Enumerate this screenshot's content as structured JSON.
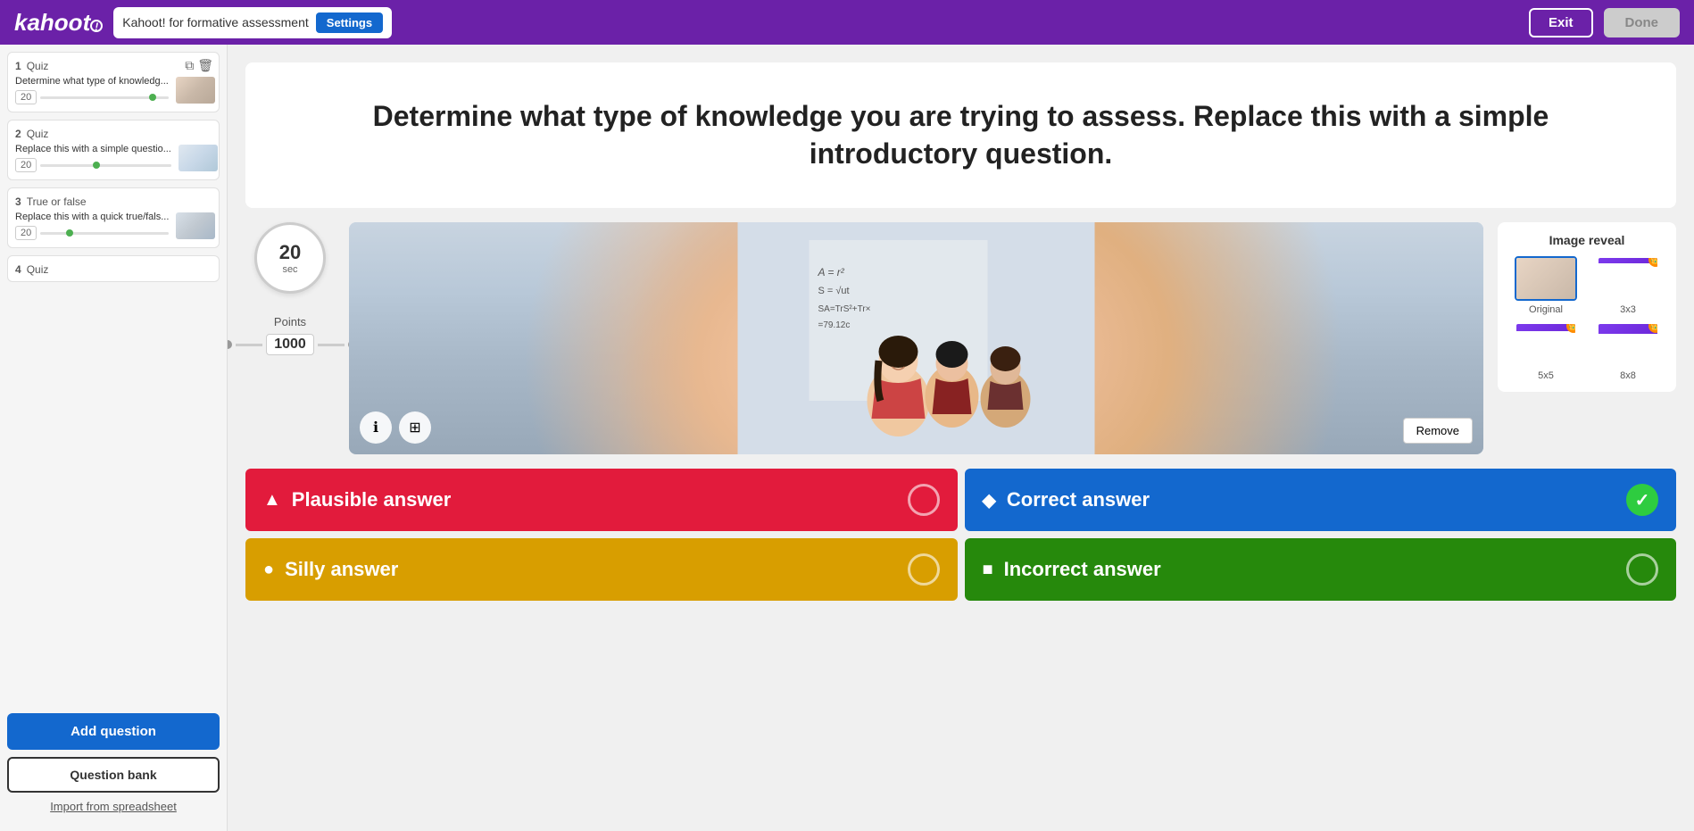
{
  "header": {
    "logo": "kahoot!",
    "title": "Kahoot! for formative assessment",
    "settings_label": "Settings",
    "exit_label": "Exit",
    "done_label": "Done"
  },
  "sidebar": {
    "items": [
      {
        "number": "1",
        "type": "Quiz",
        "text": "Determine what type of knowledg...",
        "time": "20",
        "progress_pos": "85%"
      },
      {
        "number": "2",
        "type": "Quiz",
        "text": "Replace this with a simple questio...",
        "time": "20",
        "progress_pos": "40%"
      },
      {
        "number": "3",
        "type": "True or false",
        "text": "Replace this with a quick true/fals...",
        "time": "20",
        "progress_pos": "20%"
      },
      {
        "number": "4",
        "type": "Quiz",
        "text": ""
      }
    ],
    "add_question_label": "Add question",
    "question_bank_label": "Question bank",
    "import_label": "Import from spreadsheet"
  },
  "main": {
    "question_text": "Determine what type of knowledge you are trying to assess. Replace this with a simple introductory question.",
    "timer": {
      "value": "20",
      "unit": "sec"
    },
    "points": {
      "label": "Points",
      "value": "1000"
    },
    "image_reveal": {
      "title": "Image reveal",
      "options": [
        {
          "label": "Original",
          "type": "original",
          "selected": true
        },
        {
          "label": "3x3",
          "type": "3x3",
          "selected": false
        },
        {
          "label": "5x5",
          "type": "5x5",
          "selected": false
        },
        {
          "label": "8x8",
          "type": "8x8",
          "selected": false
        }
      ]
    },
    "remove_btn_label": "Remove",
    "answers": [
      {
        "shape": "▲",
        "text": "Plausible answer",
        "color": "red",
        "indicator": "empty"
      },
      {
        "shape": "◆",
        "text": "Correct answer",
        "color": "blue",
        "indicator": "check"
      },
      {
        "shape": "●",
        "text": "Silly answer",
        "color": "yellow",
        "indicator": "empty"
      },
      {
        "shape": "■",
        "text": "Incorrect answer",
        "color": "green",
        "indicator": "empty"
      }
    ]
  }
}
